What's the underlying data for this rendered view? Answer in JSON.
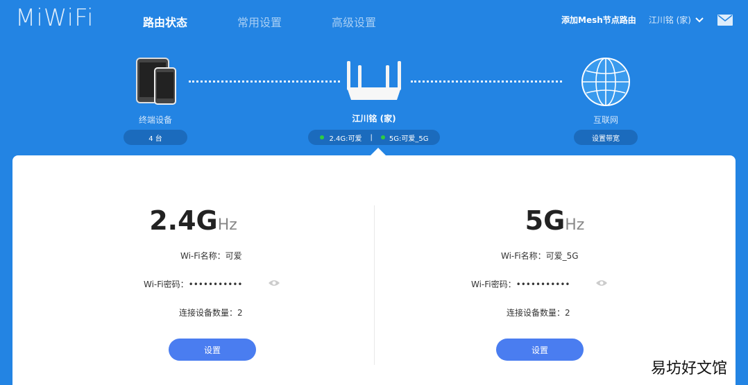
{
  "header": {
    "logo": "MiWiFi",
    "nav": [
      "路由状态",
      "常用设置",
      "高级设置"
    ],
    "mesh_link": "添加Mesh节点路由",
    "user_name": "江川铭 (家)"
  },
  "topology": {
    "devices": {
      "label": "终端设备",
      "count": "4 台"
    },
    "router": {
      "name": "江川铭 (家)",
      "band24": "2.4G:可爱",
      "separator": "|",
      "band5": "5G:可爱_5G",
      "status_color": "#2ecc40"
    },
    "internet": {
      "label": "互联网",
      "action": "设置带宽"
    }
  },
  "bands": [
    {
      "big": "2.4G",
      "unit": "Hz",
      "ssid_label": "Wi-Fi名称：",
      "ssid": "可爱",
      "pwd_label": "Wi-Fi密码：",
      "pwd": "•••••••••••",
      "conn_label": "连接设备数量：",
      "conn": "2",
      "button": "设置"
    },
    {
      "big": "5G",
      "unit": "Hz",
      "ssid_label": "Wi-Fi名称：",
      "ssid": "可爱_5G",
      "pwd_label": "Wi-Fi密码：",
      "pwd": "•••••••••••",
      "conn_label": "连接设备数量：",
      "conn": "2",
      "button": "设置"
    }
  ],
  "watermark": "易坊好文馆",
  "colors": {
    "background": "#2384e3",
    "accent": "#4a7df0",
    "pill": "#1b6bbd"
  }
}
